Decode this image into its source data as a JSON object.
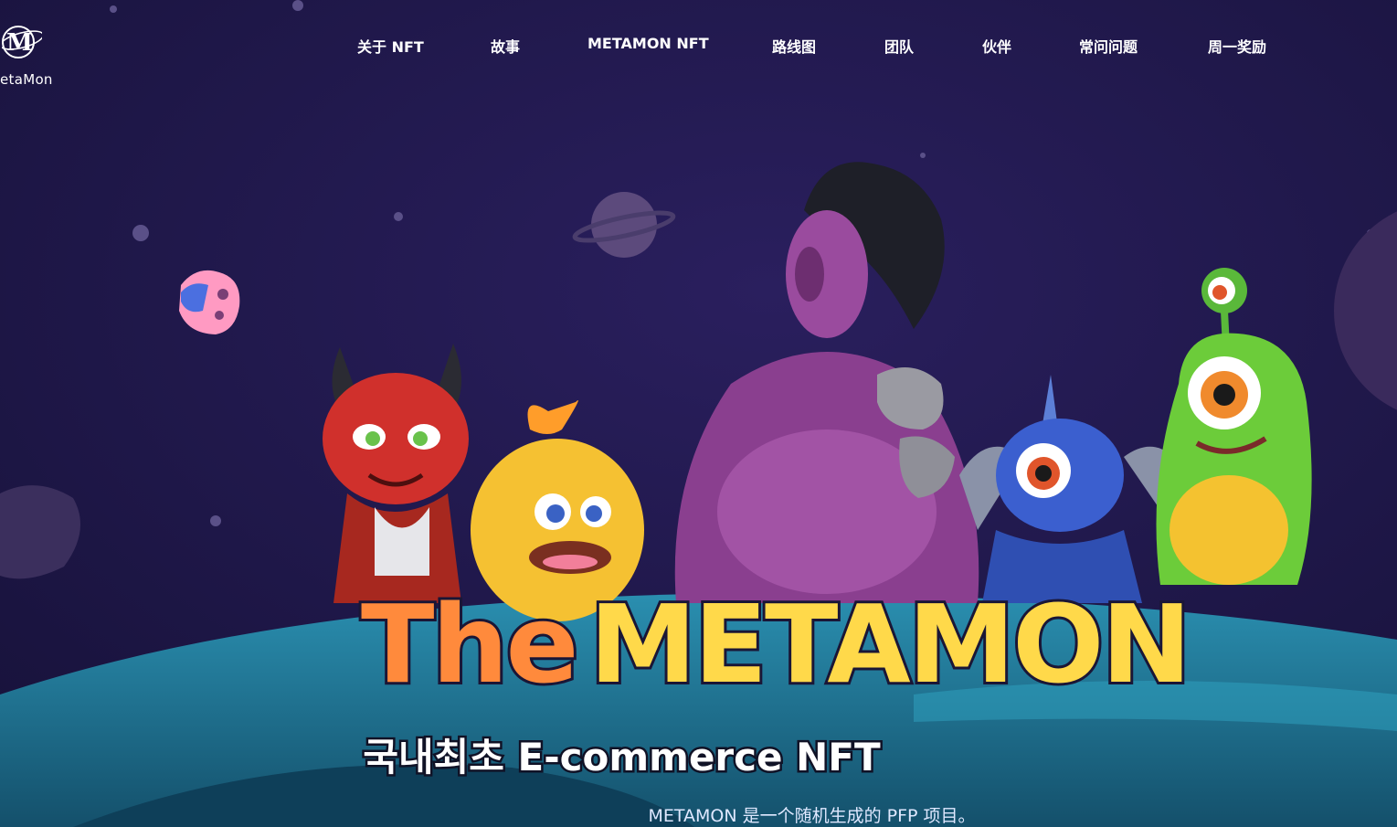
{
  "brand": {
    "logo_letter": "M",
    "logo_text": "etaMon"
  },
  "nav": {
    "items": [
      {
        "label": "关于 NFT"
      },
      {
        "label": "故事"
      },
      {
        "label": "METAMON NFT"
      },
      {
        "label": "路线图"
      },
      {
        "label": "团队"
      },
      {
        "label": "伙伴"
      },
      {
        "label": "常问问题"
      },
      {
        "label": "周一奖励"
      }
    ]
  },
  "hero": {
    "title_part1": "The",
    "title_part2": "METAMON",
    "subtitle": "국내최초 E-commerce NFT",
    "description": "METAMON 是一个随机生成的 PFP 项目。"
  },
  "colors": {
    "background": "#1c1540",
    "title_orange": "#ff8a3c",
    "title_yellow": "#ffd94a",
    "ground": "#1f6d88"
  }
}
